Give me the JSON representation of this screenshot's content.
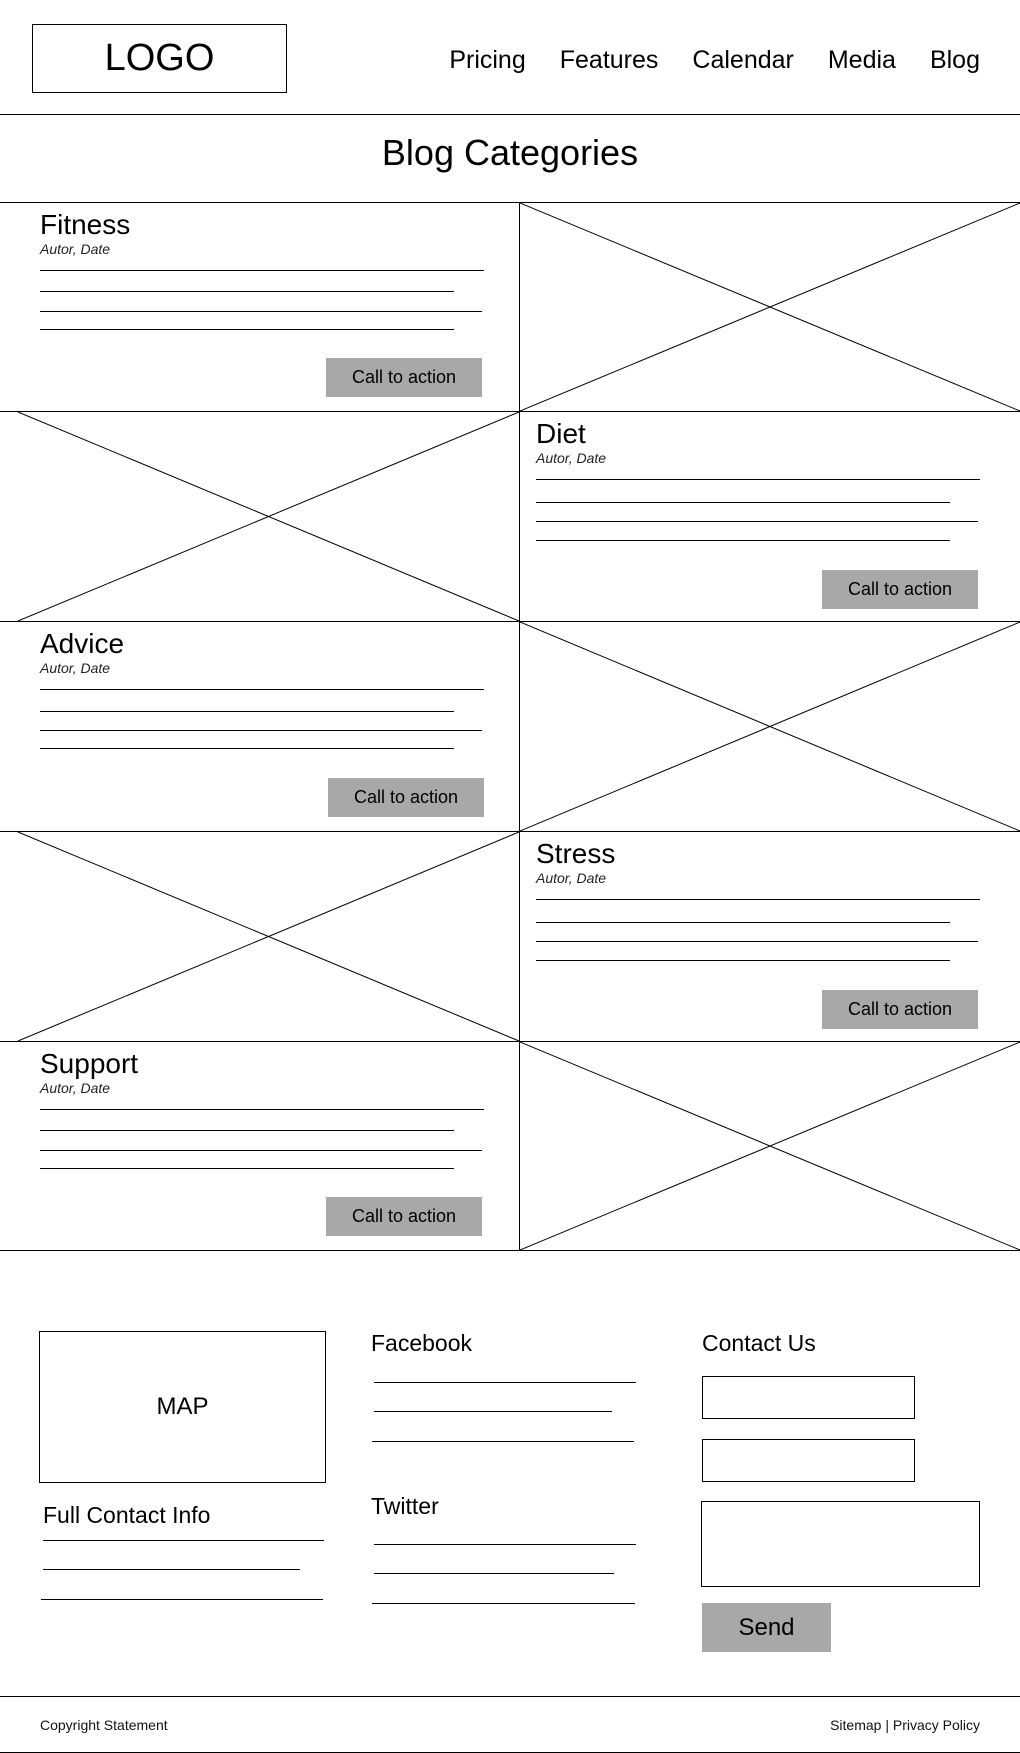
{
  "header": {
    "logo": "LOGO",
    "nav": [
      "Pricing",
      "Features",
      "Calendar",
      "Media",
      "Blog"
    ]
  },
  "page_title": "Blog Categories",
  "categories": [
    {
      "title": "Fitness",
      "meta": "Autor, Date",
      "cta": "Call to action"
    },
    {
      "title": "Diet",
      "meta": "Autor, Date",
      "cta": "Call to action"
    },
    {
      "title": "Advice",
      "meta": "Autor, Date",
      "cta": "Call to action"
    },
    {
      "title": "Stress",
      "meta": "Autor, Date",
      "cta": "Call to action"
    },
    {
      "title": "Support",
      "meta": "Autor, Date",
      "cta": "Call to action"
    }
  ],
  "footer": {
    "map": "MAP",
    "full_contact": "Full Contact Info",
    "facebook": "Facebook",
    "twitter": "Twitter",
    "contact_us": "Contact Us",
    "send": "Send",
    "copyright": "Copyright Statement",
    "links": "Sitemap | Privacy Policy"
  }
}
